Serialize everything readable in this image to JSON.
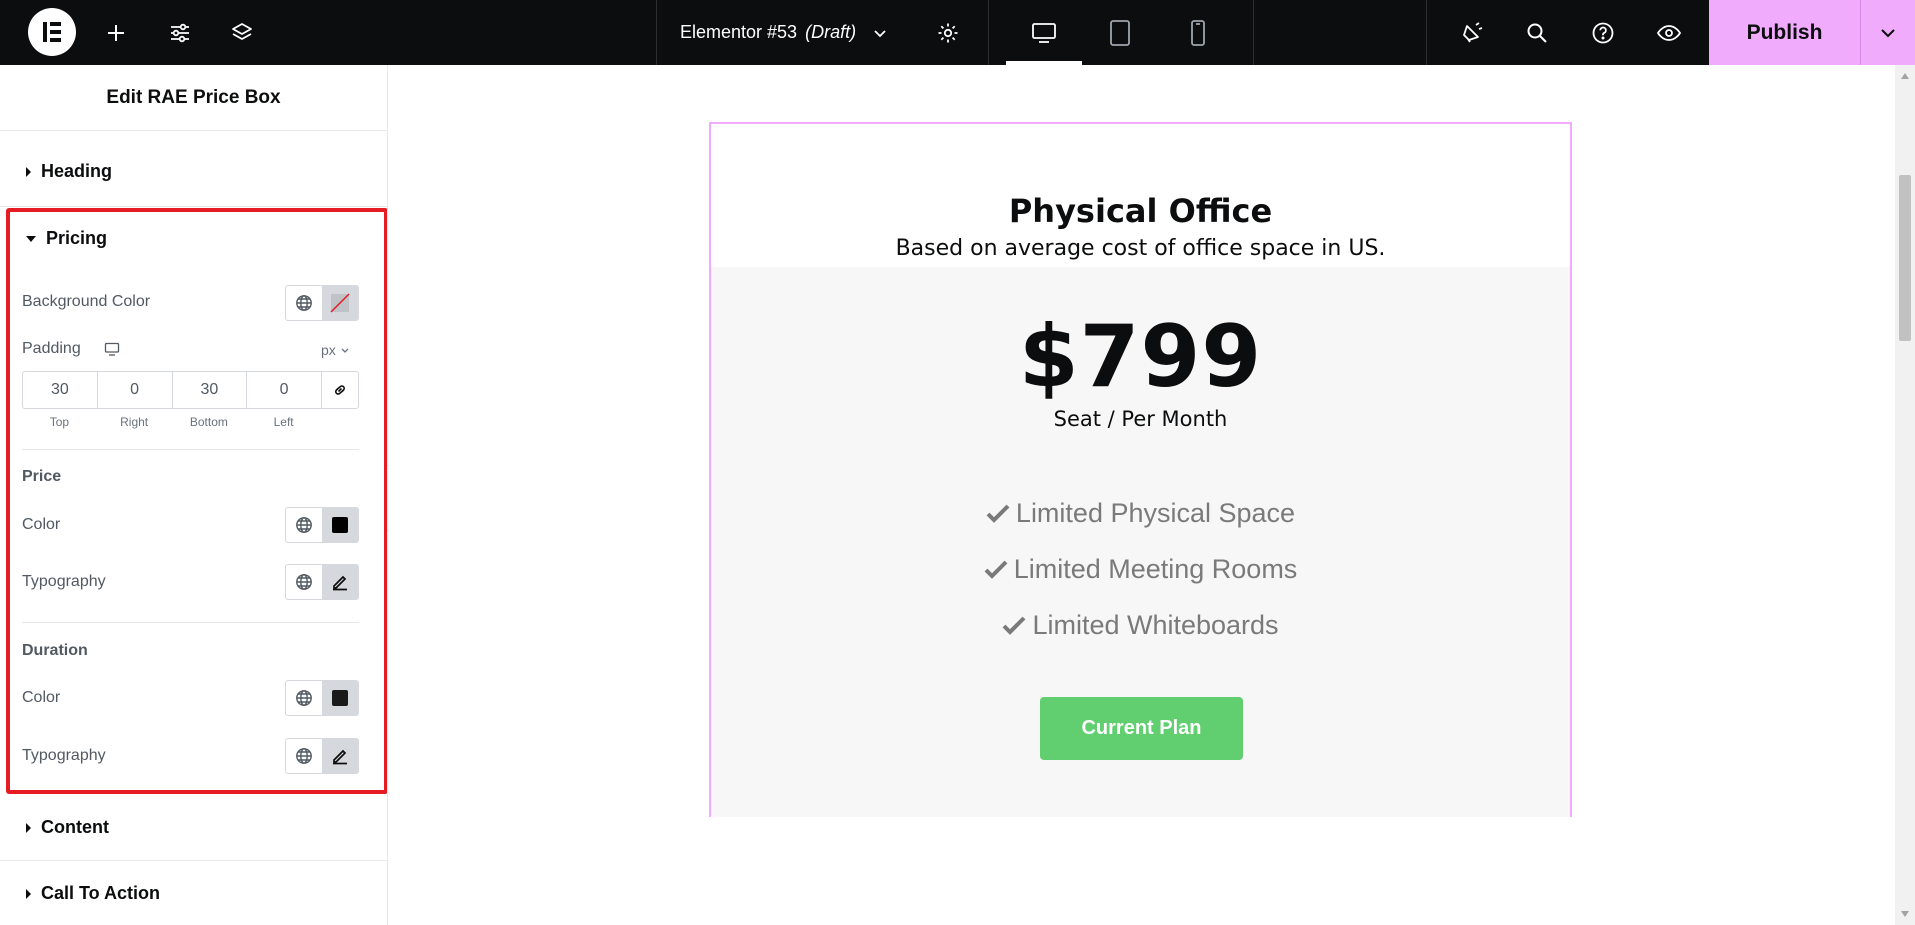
{
  "topbar": {
    "document_name": "Elementor #53",
    "document_status": "(Draft)",
    "publish_label": "Publish"
  },
  "panel": {
    "title": "Edit RAE Price Box",
    "sections": {
      "heading": "Heading",
      "pricing": "Pricing",
      "content": "Content",
      "call_to_action": "Call To Action"
    },
    "pricing": {
      "background_color_label": "Background Color",
      "padding_label": "Padding",
      "padding_unit": "px",
      "padding": {
        "top": "30",
        "right": "0",
        "bottom": "30",
        "left": "0"
      },
      "padding_labels": {
        "top": "Top",
        "right": "Right",
        "bottom": "Bottom",
        "left": "Left"
      },
      "price_heading": "Price",
      "price_color_label": "Color",
      "price_typography_label": "Typography",
      "duration_heading": "Duration",
      "duration_color_label": "Color",
      "duration_typography_label": "Typography"
    }
  },
  "pricebox": {
    "title": "Physical Office",
    "subtitle": "Based on average cost of office space in US.",
    "price": "$799",
    "duration": "Seat / Per Month",
    "features": [
      "Limited Physical Space",
      "Limited Meeting Rooms",
      "Limited Whiteboards"
    ],
    "button_label": "Current Plan"
  },
  "colors": {
    "accent": "#f0abfc",
    "button": "#61ce70",
    "highlight": "#e61c24",
    "topbar": "#0c0d0e"
  }
}
